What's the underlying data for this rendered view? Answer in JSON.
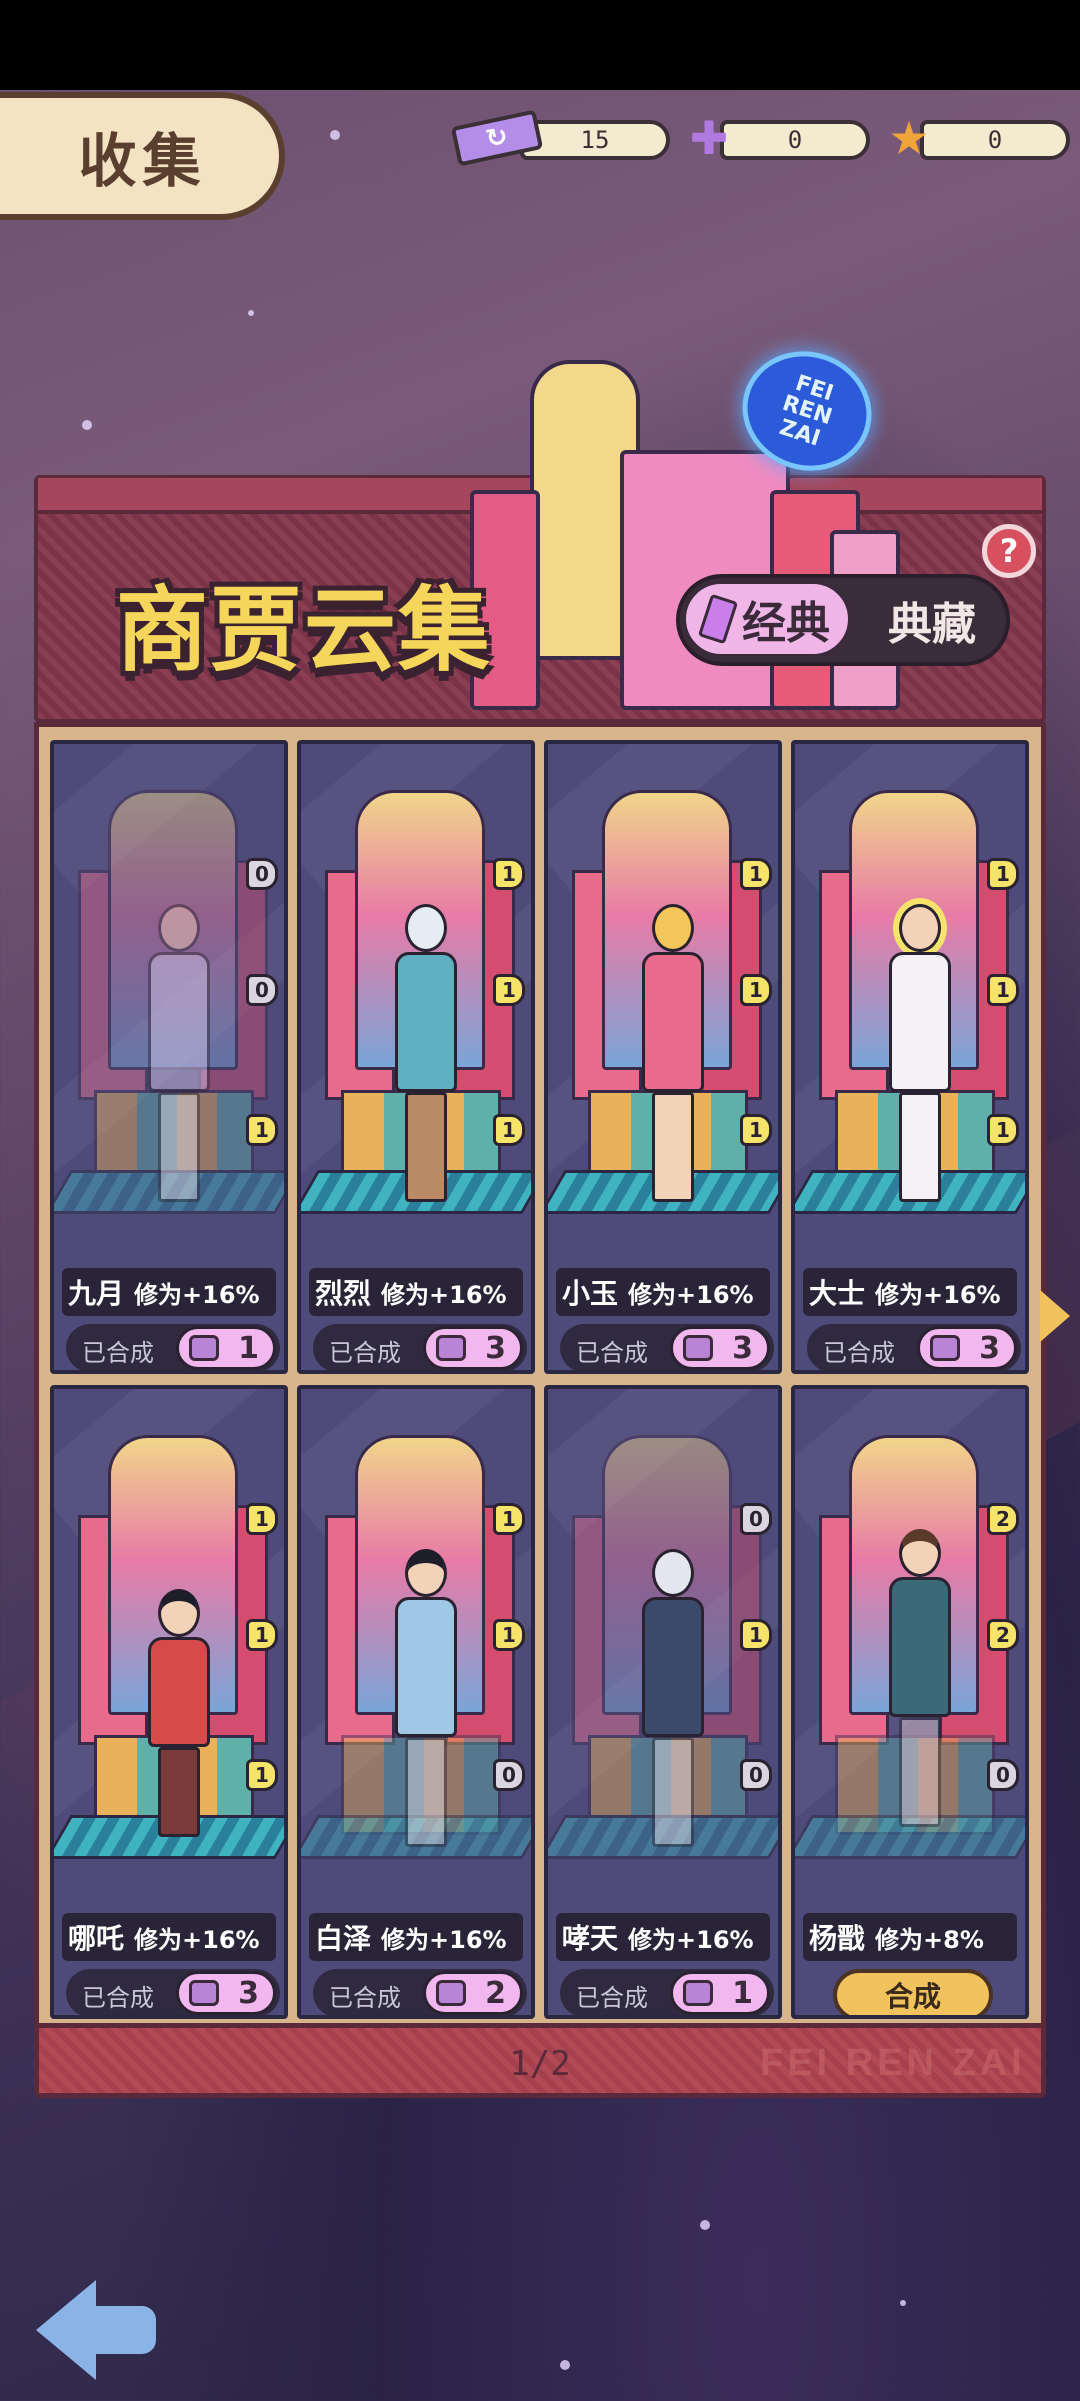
{
  "header": {
    "title": "收集",
    "resources": [
      {
        "icon": "ticket-icon",
        "value": "15"
      },
      {
        "icon": "puzzle-icon",
        "value": "0"
      },
      {
        "icon": "star-icon",
        "value": "0"
      }
    ]
  },
  "banner": {
    "title": "商贾云集",
    "sign_lines": [
      "FEI",
      "REN",
      "ZAI"
    ],
    "tabs": {
      "active": "经典",
      "inactive": "典藏"
    },
    "help": "?"
  },
  "cards": [
    {
      "name": "九月",
      "bonus": "修为+16%",
      "status": "已合成",
      "count": "1",
      "badges": [
        "0",
        "0",
        "1"
      ]
    },
    {
      "name": "烈烈",
      "bonus": "修为+16%",
      "status": "已合成",
      "count": "3",
      "badges": [
        "1",
        "1",
        "1"
      ]
    },
    {
      "name": "小玉",
      "bonus": "修为+16%",
      "status": "已合成",
      "count": "3",
      "badges": [
        "1",
        "1",
        "1"
      ]
    },
    {
      "name": "大士",
      "bonus": "修为+16%",
      "status": "已合成",
      "count": "3",
      "badges": [
        "1",
        "1",
        "1"
      ]
    },
    {
      "name": "哪吒",
      "bonus": "修为+16%",
      "status": "已合成",
      "count": "3",
      "badges": [
        "1",
        "1",
        "1"
      ]
    },
    {
      "name": "白泽",
      "bonus": "修为+16%",
      "status": "已合成",
      "count": "2",
      "badges": [
        "1",
        "1",
        "0"
      ]
    },
    {
      "name": "哮天",
      "bonus": "修为+16%",
      "status": "已合成",
      "count": "1",
      "badges": [
        "0",
        "1",
        "0"
      ]
    },
    {
      "name": "杨戬",
      "bonus": "修为+8%",
      "button": "合成",
      "badges": [
        "2",
        "2",
        "0"
      ]
    }
  ],
  "pagination": {
    "label": "1/2"
  },
  "watermark": "FEI REN ZAI",
  "colors": {
    "accent": "#f2c35c",
    "gold_title": "#f6d65a",
    "card_bg": "#4e4a7a",
    "pink_pill": "#f3b7ef"
  }
}
